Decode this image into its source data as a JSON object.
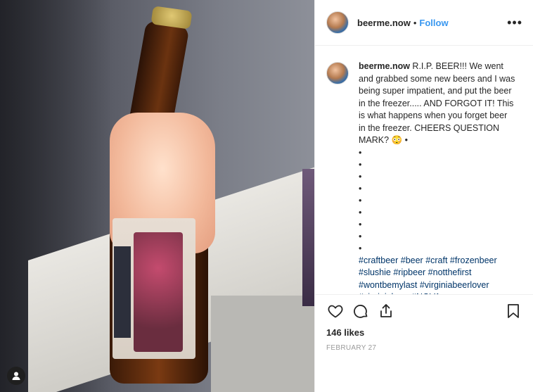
{
  "post": {
    "username": "beerme.now",
    "follow_label": "Follow",
    "separator": "•",
    "more_label": "•••",
    "caption": "R.I.P. BEER!!! We went and grabbed some new beers and I was being super impatient, and put the beer in the freezer..... AND FORGOT IT! This is what happens when you forget beer in the freezer. CHEERS QUESTION MARK? 😳 •",
    "bullets": [
      "•",
      "•",
      "•",
      "•",
      "•",
      "•",
      "•",
      "•",
      "•"
    ],
    "hashtags": "#craftbeer #beer #craft #frozenbeer #slushie #ripbeer #notthefirst #wontbemylast #virginiabeerlover #virginiabeer #NOVA",
    "likes": "146 likes",
    "date": "FEBRUARY 27"
  },
  "icons": {
    "like": "heart-icon",
    "comment": "comment-icon",
    "share": "share-icon",
    "save": "bookmark-icon",
    "more": "more-icon",
    "user_badge": "user-icon"
  },
  "colors": {
    "accent": "#3897f0",
    "hashtag": "#003569",
    "meta": "#999999"
  }
}
